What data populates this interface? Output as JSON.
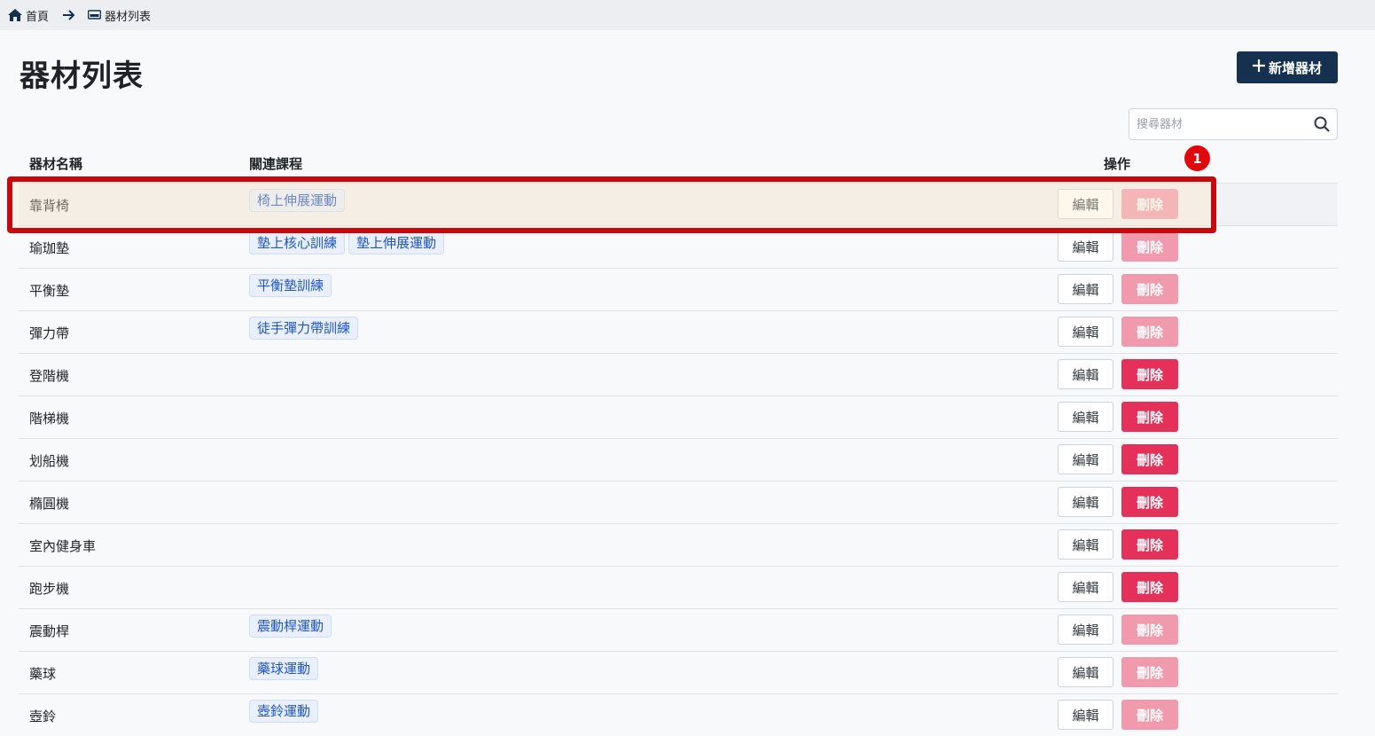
{
  "breadcrumb": {
    "home_label": "首頁",
    "current_label": "器材列表"
  },
  "page": {
    "title": "器材列表",
    "add_button_label": "新增器材"
  },
  "search": {
    "placeholder": "搜尋器材"
  },
  "table": {
    "headers": {
      "name": "器材名稱",
      "courses": "關連課程",
      "actions": "操作"
    },
    "edit_label": "編輯",
    "delete_label": "刪除",
    "rows": [
      {
        "name": "靠背椅",
        "courses": [
          "椅上伸展運動"
        ],
        "delete_enabled": false
      },
      {
        "name": "瑜珈墊",
        "courses": [
          "墊上核心訓練",
          "墊上伸展運動"
        ],
        "delete_enabled": false
      },
      {
        "name": "平衡墊",
        "courses": [
          "平衡墊訓練"
        ],
        "delete_enabled": false
      },
      {
        "name": "彈力帶",
        "courses": [
          "徒手彈力帶訓練"
        ],
        "delete_enabled": false
      },
      {
        "name": "登階機",
        "courses": [],
        "delete_enabled": true
      },
      {
        "name": "階梯機",
        "courses": [],
        "delete_enabled": true
      },
      {
        "name": "划船機",
        "courses": [],
        "delete_enabled": true
      },
      {
        "name": "橢圓機",
        "courses": [],
        "delete_enabled": true
      },
      {
        "name": "室內健身車",
        "courses": [],
        "delete_enabled": true
      },
      {
        "name": "跑步機",
        "courses": [],
        "delete_enabled": true
      },
      {
        "name": "震動桿",
        "courses": [
          "震動桿運動"
        ],
        "delete_enabled": false
      },
      {
        "name": "藥球",
        "courses": [
          "藥球運動"
        ],
        "delete_enabled": false
      },
      {
        "name": "壺鈴",
        "courses": [
          "壺鈴運動"
        ],
        "delete_enabled": false
      }
    ]
  },
  "annotation": {
    "marker_label": "1",
    "highlight_color": "#c8080c"
  },
  "colors": {
    "primary": "#16304f",
    "danger": "#e5305a",
    "danger_disabled": "#f29aad",
    "tag_text": "#1f55c6"
  }
}
